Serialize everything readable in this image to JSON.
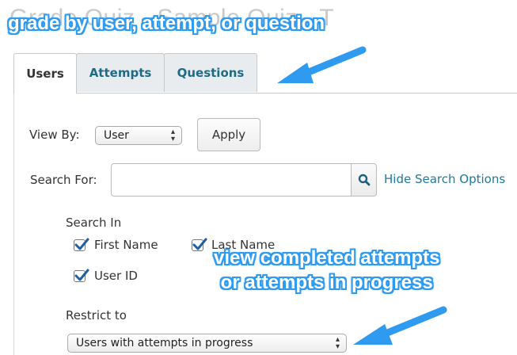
{
  "page": {
    "title": "Grade Quiz - Sample Quiz - T"
  },
  "callouts": {
    "top": "grade by user, attempt, or question",
    "middle_line1": "view completed attempts",
    "middle_line2": "or attempts in progress"
  },
  "tabs": [
    {
      "label": "Users",
      "active": true
    },
    {
      "label": "Attempts",
      "active": false
    },
    {
      "label": "Questions",
      "active": false
    }
  ],
  "view_by": {
    "label": "View By:",
    "selected": "User",
    "apply_label": "Apply"
  },
  "search": {
    "label": "Search For:",
    "value": "",
    "hide_options_label": "Hide Search Options"
  },
  "search_in": {
    "heading": "Search In",
    "options": [
      {
        "label": "First Name",
        "checked": true
      },
      {
        "label": "Last Name",
        "checked": true
      },
      {
        "label": "User ID",
        "checked": true
      }
    ]
  },
  "restrict": {
    "heading": "Restrict to",
    "selected": "Users with attempts in progress"
  },
  "colors": {
    "callout": "#2e9af0",
    "link": "#1f7a9c",
    "checkmark": "#1f5fa8"
  },
  "icons": {
    "search": "magnifier-icon",
    "select": "up-down-arrows-icon",
    "callout_arrow": "arrow-icon"
  }
}
